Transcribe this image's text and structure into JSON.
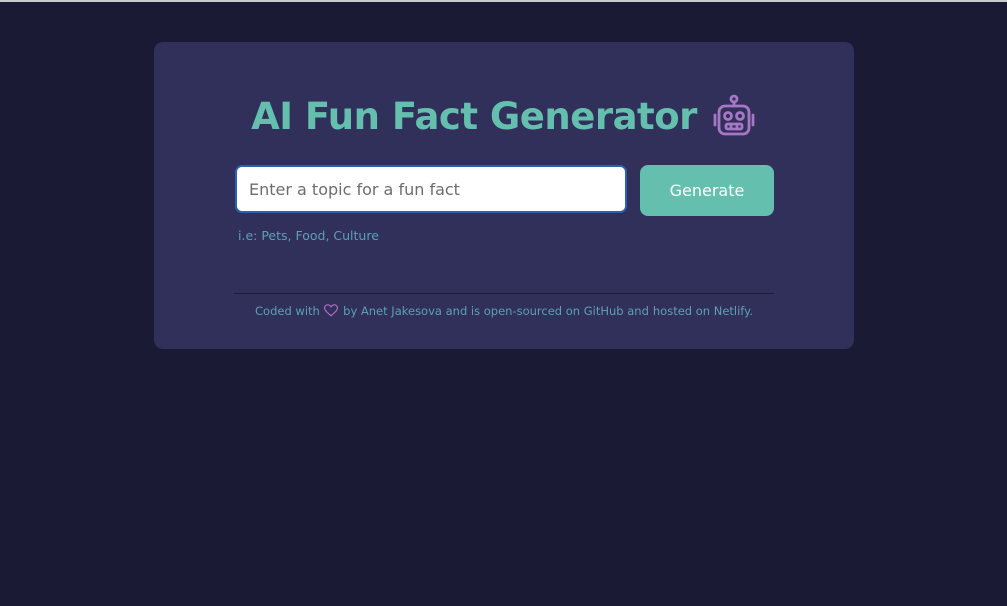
{
  "header": {
    "title": "AI Fun Fact Generator",
    "icon": "robot-icon"
  },
  "form": {
    "input_placeholder": "Enter a topic for a fun fact",
    "input_value": "",
    "generate_label": "Generate",
    "hint": "i.e: Pets, Food, Culture"
  },
  "footer": {
    "coded_with": "Coded with",
    "heart_icon": "heart-icon",
    "by": "by",
    "author": "Anet Jakesova",
    "middle": "and is",
    "opensource_link": "open-sourced on GitHub",
    "and_text": "and",
    "hosted_link": "hosted on Netlify",
    "end": "."
  },
  "colors": {
    "background": "#1b1a35",
    "card": "#30305a",
    "accent": "#64bfae",
    "muted_text": "#5d9fb8",
    "icon_purple": "#a777c6"
  }
}
